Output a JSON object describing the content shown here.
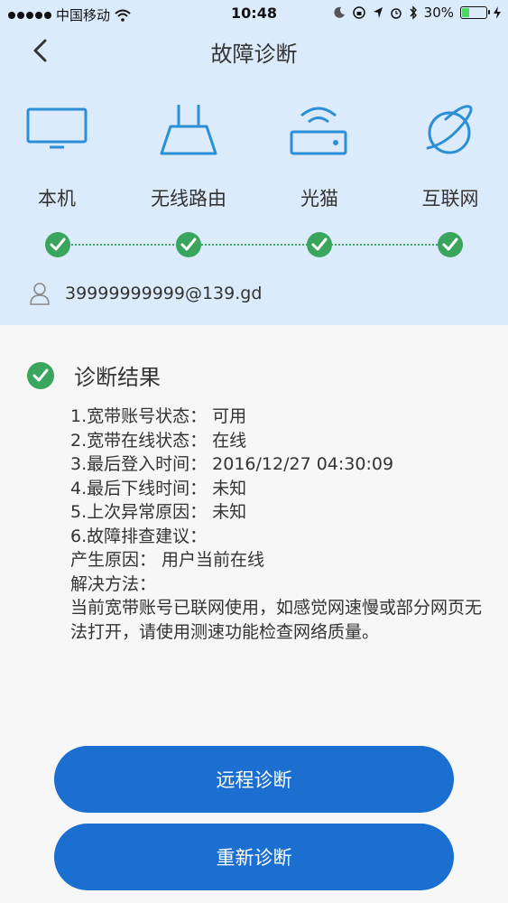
{
  "status_bar": {
    "carrier": "中国移动",
    "time": "10:48",
    "battery": "30%",
    "battery_level": 0.3
  },
  "header": {
    "title": "故障诊断"
  },
  "devices": [
    {
      "label": "本机",
      "icon": "monitor-icon"
    },
    {
      "label": "无线路由",
      "icon": "router-icon"
    },
    {
      "label": "光猫",
      "icon": "modem-icon"
    },
    {
      "label": "互联网",
      "icon": "internet-globe-icon"
    }
  ],
  "account": {
    "id": "39999999999@139.gd",
    "icon": "user-icon"
  },
  "result": {
    "title": "诊断结果",
    "lines": [
      "1.宽带账号状态：  可用",
      "2.宽带在线状态：  在线",
      "3.最后登入时间：  2016/12/27 04:30:09",
      "4.最后下线时间：  未知",
      "5.上次异常原因：  未知",
      "6.故障排查建议：",
      "产生原因：  用户当前在线",
      "解决方法：",
      "当前宽带账号已联网使用，如感觉网速慢或部分网页无法打开，请使用测速功能检查网络质量。"
    ]
  },
  "buttons": {
    "remote": "远程诊断",
    "retry": "重新诊断"
  },
  "colors": {
    "header_bg": "#dcebfb",
    "accent": "#1a6fd0",
    "success": "#3aa55c",
    "icon_blue": "#2b8fd8"
  }
}
